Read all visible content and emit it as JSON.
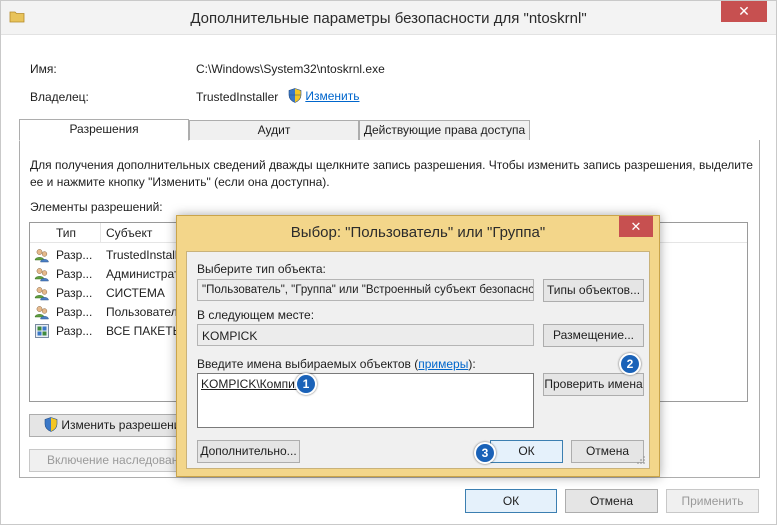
{
  "window": {
    "title": "Дополнительные параметры безопасности  для \"ntoskrnl\"",
    "close": "✕"
  },
  "info": {
    "name_label": "Имя:",
    "name_value": "C:\\Windows\\System32\\ntoskrnl.exe",
    "owner_label": "Владелец:",
    "owner_value": "TrustedInstaller",
    "change_link": "Изменить"
  },
  "tabs": [
    {
      "label": "Разрешения"
    },
    {
      "label": "Аудит"
    },
    {
      "label": "Действующие права доступа"
    }
  ],
  "permissions": {
    "description": "Для получения дополнительных сведений дважды щелкните запись разрешения. Чтобы изменить запись разрешения, выделите ее и нажмите кнопку \"Изменить\" (если она доступна).",
    "description_line1": "Для получения дополнительных сведений дважды щелкните запись разрешения. Чтобы изменить запись разрешения, выделите",
    "description_line2": "ее и нажмите кнопку \"Изменить\" (если она доступна).",
    "elements_label": "Элементы разрешений:",
    "columns": [
      "Тип",
      "Субъект"
    ],
    "rows": [
      {
        "type": "Разр...",
        "subject": "TrustedInstall...",
        "icon": "users-icon"
      },
      {
        "type": "Разр...",
        "subject": "Администрат...",
        "icon": "users-icon"
      },
      {
        "type": "Разр...",
        "subject": "СИСТЕМА",
        "icon": "users-icon"
      },
      {
        "type": "Разр...",
        "subject": "Пользовател...",
        "icon": "users-icon"
      },
      {
        "type": "Разр...",
        "subject": "ВСЕ ПАКЕТЫ ...",
        "icon": "packages-icon"
      }
    ],
    "change_permissions_button": "Изменить разрешения",
    "inheritance_button": "Включение наследования"
  },
  "footer": {
    "ok": "ОК",
    "cancel": "Отмена",
    "apply": "Применить"
  },
  "dialog": {
    "title": "Выбор: \"Пользователь\" или \"Группа\"",
    "close": "✕",
    "object_type_label": "Выберите тип объекта:",
    "object_type_value": "\"Пользователь\", \"Группа\" или \"Встроенный субъект безопасности\"",
    "object_types_button": "Типы объектов...",
    "location_label": "В следующем месте:",
    "location_value": "KOMPICK",
    "location_button": "Размещение...",
    "names_label_prefix": "Введите имена выбираемых объектов (",
    "names_label_link": "примеры",
    "names_label_suffix": "):",
    "names_value": "KOMPICK\\Компик",
    "check_names_button": "Проверить имена",
    "advanced_button": "Дополнительно...",
    "ok_button": "ОК",
    "cancel_button": "Отмена"
  },
  "annotations": [
    "1",
    "2",
    "3"
  ]
}
